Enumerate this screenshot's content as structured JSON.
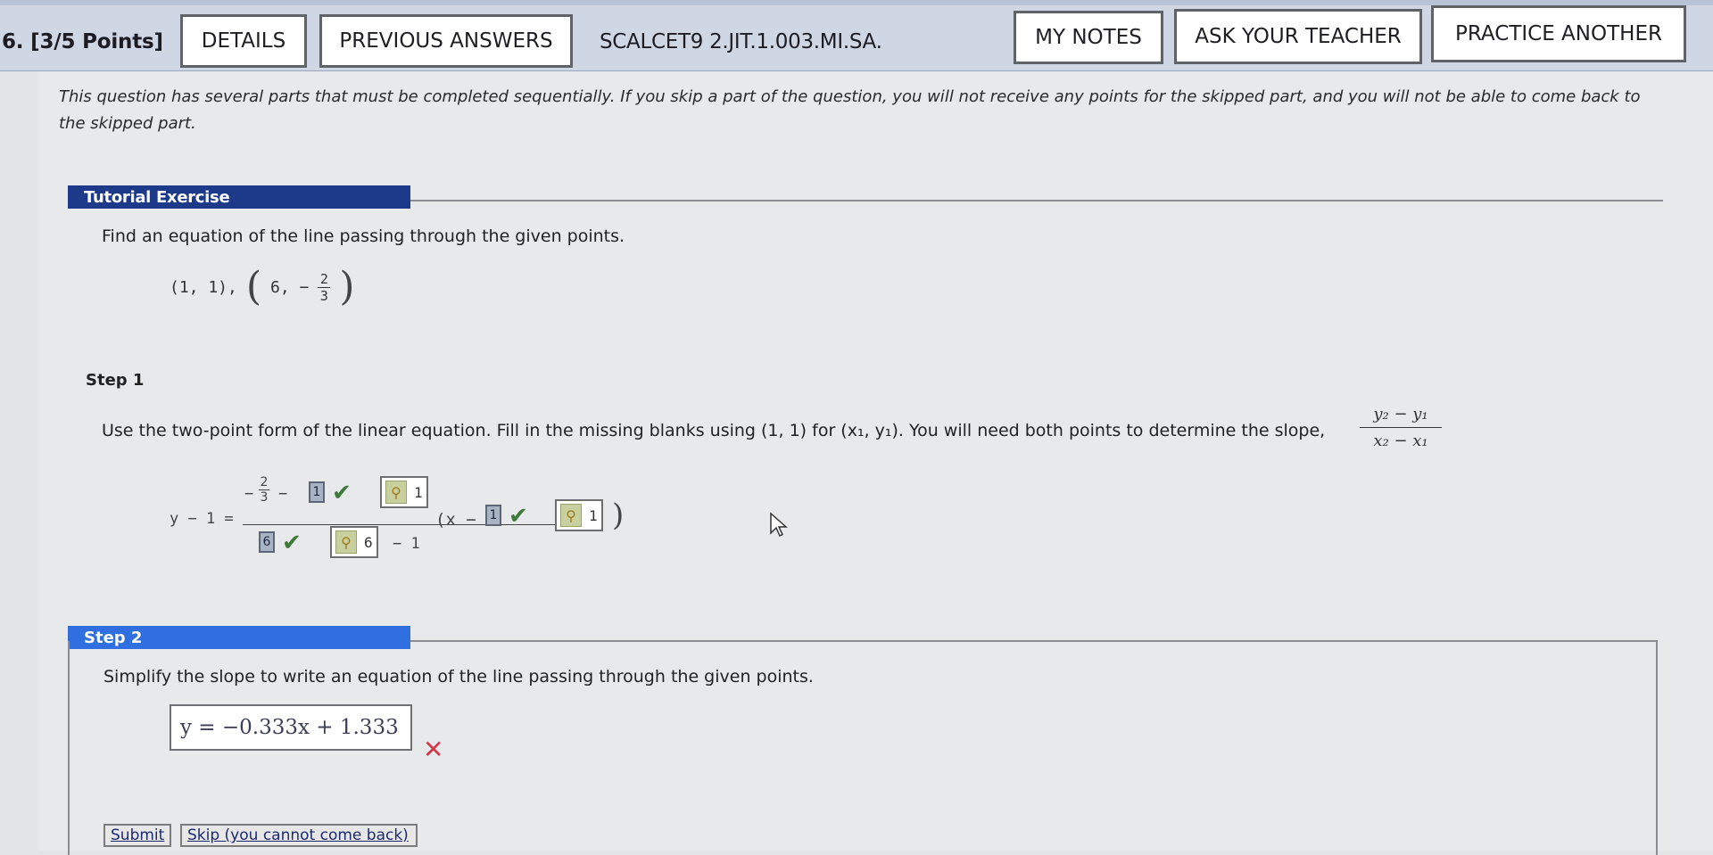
{
  "header": {
    "question_number": "6.",
    "points": "[3/5 Points]",
    "details_label": "DETAILS",
    "previous_answers_label": "PREVIOUS ANSWERS",
    "assignment_code": "SCALCET9 2.JIT.1.003.MI.SA.",
    "my_notes_label": "MY NOTES",
    "ask_teacher_label": "ASK YOUR TEACHER",
    "practice_another_label": "PRACTICE ANOTHER"
  },
  "notice": "This question has several parts that must be completed sequentially. If you skip a part of the question, you will not receive any points for the skipped part, and you will not be able to come back to the skipped part.",
  "tutorial": {
    "label": "Tutorial Exercise",
    "prompt": "Find an equation of the line passing through the given points.",
    "point1": "(1, 1),",
    "point2_x": "6, −",
    "point2_num": "2",
    "point2_den": "3"
  },
  "step1": {
    "label": "Step 1",
    "instruction": "Use the two-point form of the linear equation. Fill in the missing blanks using (1, 1) for (x₁, y₁). You will need both points to determine the slope,",
    "slope_numerator": "y₂ − y₁",
    "slope_denominator": "x₂ − x₁",
    "equation": {
      "lhs": "y − 1 =",
      "num_frac_top": "2",
      "num_frac_bottom": "3",
      "num_minus_sign": "−",
      "num_minus": "−",
      "num_answer": "1",
      "num_key_value": "1",
      "den_answer": "6",
      "den_key_value": "6",
      "den_minus": "− 1",
      "paren_open": "(x −",
      "paren_answer": "1",
      "paren_key_value": "1",
      "paren_close": ")"
    }
  },
  "step2": {
    "label": "Step 2",
    "instruction": "Simplify the slope to write an equation of the line passing through the given points.",
    "answer_value": "y = −0.333x + 1.333",
    "result_mark": "✕"
  },
  "buttons": {
    "submit": "Submit",
    "skip": "Skip (you cannot come back)"
  },
  "icons": {
    "check": "✔",
    "key": "🔑"
  },
  "colors": {
    "header_bg": "#cfd6e4",
    "tutorial_bar": "#1d3a8a",
    "step2_bar": "#2f6fe0",
    "check_green": "#3f7a3a",
    "error_red": "#d0384b"
  }
}
